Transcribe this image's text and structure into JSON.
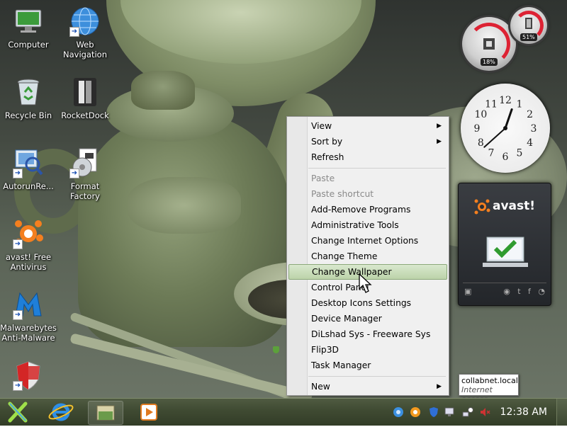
{
  "desktop": {
    "icons": [
      {
        "label": "Computer"
      },
      {
        "label": "Web Navigation"
      },
      {
        "label": "Recycle Bin"
      },
      {
        "label": "RocketDock"
      },
      {
        "label": "AutorunRe..."
      },
      {
        "label": "Format Factory"
      },
      {
        "label": "avast! Free Antivirus"
      },
      {
        "label": "Malwarebytes Anti-Malware"
      },
      {
        "label": "Shield"
      }
    ]
  },
  "gadgets": {
    "cpu_meter": {
      "cpu_percent": "18%",
      "memory_percent": "51%"
    },
    "clock": {
      "hour": 12,
      "minute": 38
    },
    "avast": {
      "brand": "avast!",
      "status_icon": "check-icon",
      "footer_icons": [
        "window-icon",
        "globe-icon",
        "twitter-icon",
        "facebook-icon",
        "rss-icon"
      ]
    }
  },
  "context_menu": {
    "items": [
      {
        "label": "View",
        "submenu": true
      },
      {
        "label": "Sort by",
        "submenu": true
      },
      {
        "label": "Refresh"
      },
      {
        "label": "Paste",
        "disabled": true
      },
      {
        "label": "Paste shortcut",
        "disabled": true
      },
      {
        "label": "Add-Remove Programs"
      },
      {
        "label": "Administrative Tools"
      },
      {
        "label": "Change Internet Options"
      },
      {
        "label": "Change Theme"
      },
      {
        "label": "Change Wallpaper",
        "highlighted": true
      },
      {
        "label": "Control Panel"
      },
      {
        "label": "Desktop Icons Settings"
      },
      {
        "label": "Device Manager"
      },
      {
        "label": "DiLshad Sys - Freeware Sys"
      },
      {
        "label": "Flip3D",
        "icon": "shield-icon"
      },
      {
        "label": "Task Manager"
      },
      {
        "label": "New",
        "submenu": true
      }
    ],
    "submenu_glyph": "▶"
  },
  "tooltip": {
    "title": "collabnet.local",
    "subtitle": "Internet access"
  },
  "taskbar": {
    "start_icon": "start-x-icon",
    "pinned": [
      "internet-explorer-icon",
      "folder-icon",
      "media-player-icon"
    ],
    "tray_icons": [
      "blue-circle-icon",
      "orange-circle-icon",
      "shield-tray-icon",
      "computer-tray-icon",
      "network-icon",
      "volume-muted-icon"
    ],
    "clock": "12:38 AM"
  }
}
